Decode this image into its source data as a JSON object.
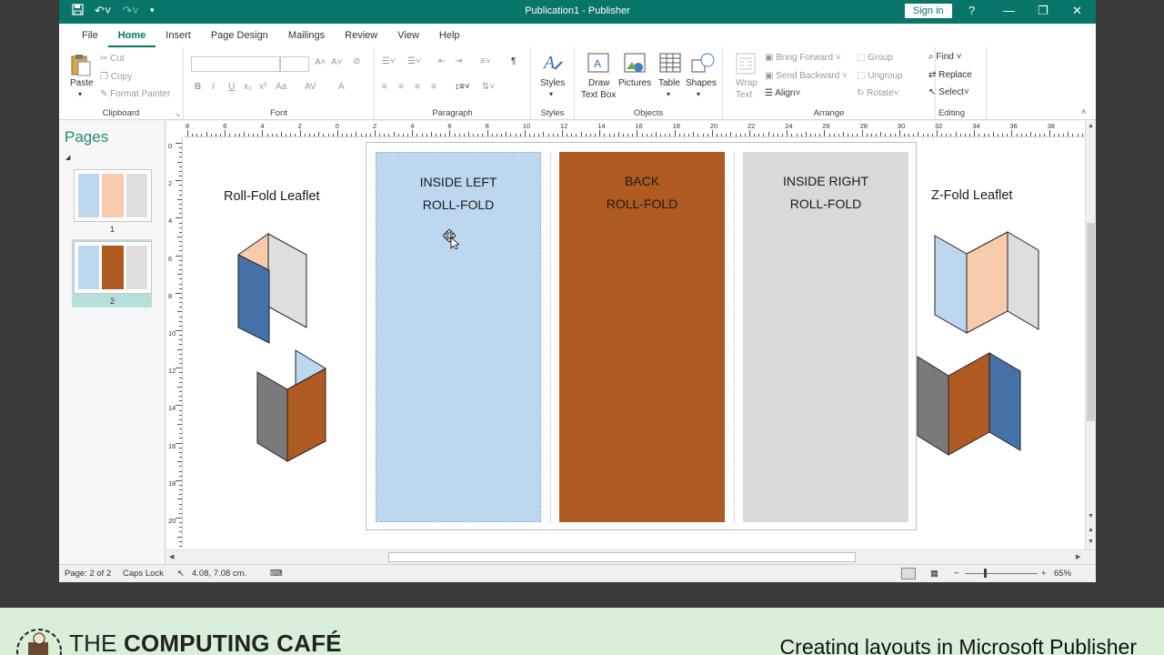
{
  "window": {
    "title": "Publication1 - Publisher",
    "sign_in": "Sign in",
    "help": "?",
    "minimize": "—",
    "restore": "❐",
    "close": "✕"
  },
  "tabs": [
    "File",
    "Home",
    "Insert",
    "Page Design",
    "Mailings",
    "Review",
    "View",
    "Help"
  ],
  "active_tab": "Home",
  "ribbon": {
    "clipboard": {
      "label": "Clipboard",
      "paste": "Paste",
      "cut": "Cut",
      "copy": "Copy",
      "format_painter": "Format Painter"
    },
    "font": {
      "label": "Font",
      "bold": "B",
      "italic": "I",
      "underline": "U",
      "subscript": "x₂",
      "superscript": "x²",
      "case": "Aa",
      "grow": "A˄",
      "shrink": "A˅",
      "spacing": "AV",
      "color": "A"
    },
    "paragraph": {
      "label": "Paragraph",
      "pilcrow": "¶"
    },
    "styles": {
      "label": "Styles",
      "styles": "Styles"
    },
    "objects": {
      "label": "Objects",
      "draw_text_box_1": "Draw",
      "draw_text_box_2": "Text Box",
      "pictures": "Pictures",
      "table": "Table",
      "shapes": "Shapes"
    },
    "arrange": {
      "label": "Arrange",
      "wrap_text_1": "Wrap",
      "wrap_text_2": "Text",
      "bring_forward": "Bring Forward",
      "send_backward": "Send Backward",
      "align": "Align",
      "group": "Group",
      "ungroup": "Ungroup",
      "rotate": "Rotate"
    },
    "editing": {
      "label": "Editing",
      "find": "Find",
      "replace": "Replace",
      "select": "Select"
    }
  },
  "pages_pane": {
    "title": "Pages",
    "pages": [
      {
        "number": "1",
        "colors": [
          "#bdd7ee",
          "#f8cbad",
          "#dedede"
        ]
      },
      {
        "number": "2",
        "colors": [
          "#bdd7ee",
          "#ae5a21",
          "#dedede"
        ]
      }
    ],
    "selected_page": "2"
  },
  "ruler": {
    "h_labels": [
      "8",
      "6",
      "4",
      "2",
      "0",
      "2",
      "4",
      "6",
      "8",
      "10",
      "12",
      "14",
      "16",
      "18",
      "20",
      "22",
      "24",
      "26",
      "28",
      "30",
      "32",
      "34",
      "36",
      "38"
    ],
    "v_labels": [
      "0",
      "2",
      "4",
      "6",
      "8",
      "10",
      "12",
      "14",
      "16",
      "18",
      "20"
    ]
  },
  "leaflets": {
    "roll_fold_label": "Roll-Fold Leaflet",
    "z_fold_label": "Z-Fold Leaflet"
  },
  "panels": [
    {
      "line1": "INSIDE LEFT",
      "line2": "ROLL-FOLD",
      "color": "#bdd7ee"
    },
    {
      "line1": "BACK",
      "line2": "ROLL-FOLD",
      "color": "#ae5a21"
    },
    {
      "line1": "INSIDE RIGHT",
      "line2": "ROLL-FOLD",
      "color": "#d9d9d9"
    }
  ],
  "colors": {
    "accent": "#077568",
    "peach": "#f8cbad",
    "light_blue": "#bdd7ee",
    "steel_blue": "#4472a8",
    "rust": "#ae5a21",
    "grey": "#dedede",
    "dark_grey": "#7a7a7a"
  },
  "status": {
    "page": "Page: 2 of 2",
    "caps_lock": "Caps Lock",
    "position": "4.08, 7.08 cm.",
    "zoom": "65%",
    "zoom_out": "−",
    "zoom_in": "+"
  },
  "banner": {
    "brand_prefix": "THE ",
    "brand_bold": "COMPUTING CAFÉ",
    "caption": "Creating layouts in Microsoft Publisher"
  }
}
